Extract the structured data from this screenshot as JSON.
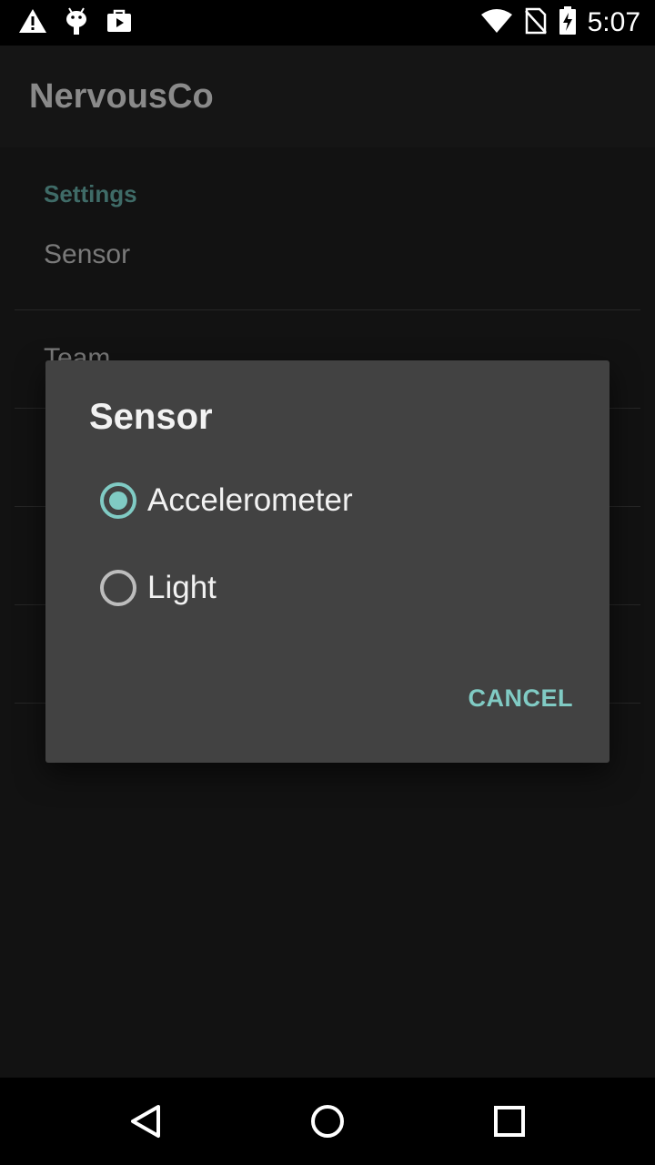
{
  "status_bar": {
    "time": "5:07",
    "icons_left": [
      "warning-icon",
      "android-debug-icon",
      "play-store-icon"
    ],
    "icons_right": [
      "wifi-icon",
      "no-sim-icon",
      "battery-charging-icon"
    ]
  },
  "app_bar": {
    "title": "NervousCo"
  },
  "settings": {
    "category": "Settings",
    "items": [
      {
        "label": "Sensor"
      },
      {
        "label": "Team"
      }
    ]
  },
  "dialog": {
    "title": "Sensor",
    "options": [
      {
        "label": "Accelerometer",
        "selected": true
      },
      {
        "label": "Light",
        "selected": false
      }
    ],
    "cancel_label": "CANCEL"
  },
  "nav_bar": {
    "icons": [
      "back-icon",
      "home-icon",
      "recents-icon"
    ]
  },
  "colors": {
    "accent": "#80cbc4",
    "dialog_bg": "#424242",
    "scrim_bg": "#121212",
    "category_text": "#3f6b67"
  }
}
